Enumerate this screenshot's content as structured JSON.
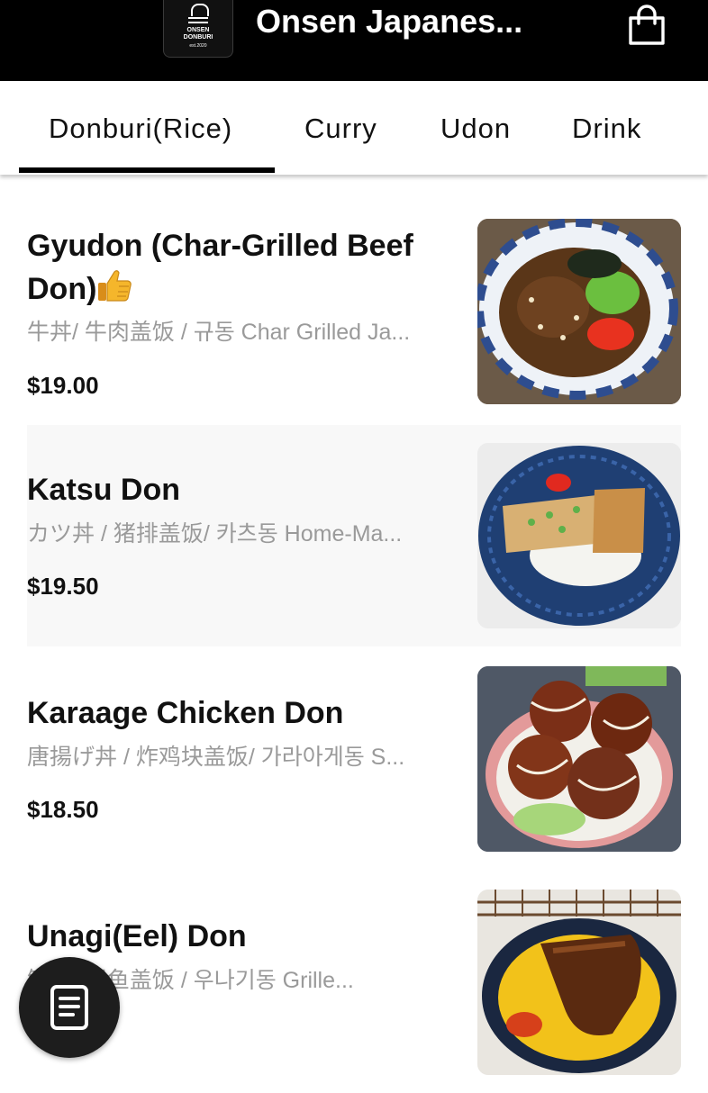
{
  "header": {
    "title": "Onsen Japanes...",
    "logo_line1": "ONSEN",
    "logo_line2": "DONBURI",
    "logo_line3": "est.2020",
    "cart_icon": "shopping-bag-icon"
  },
  "tabs": [
    {
      "label": "Donburi(Rice)",
      "active": true
    },
    {
      "label": "Curry",
      "active": false
    },
    {
      "label": "Udon",
      "active": false
    },
    {
      "label": "Drink",
      "active": false
    }
  ],
  "menu_items": [
    {
      "name": "Gyudon (Char-Grilled Beef Don)",
      "emoji": "thumbs-up-icon",
      "description": "牛丼/ 牛肉盖饭 / 규동 Char Grilled Ja...",
      "price": "$19.00",
      "image": "gyudon-photo"
    },
    {
      "name": "Katsu Don",
      "description": "カツ丼 / 猪排盖饭/ 카츠동 Home-Ma...",
      "price": "$19.50",
      "image": "katsu-don-photo"
    },
    {
      "name": "Karaage Chicken Don",
      "description": "唐揚げ丼 / 炸鸡块盖饭/ 가라아게동 S...",
      "price": "$18.50",
      "image": "karaage-don-photo"
    },
    {
      "name": "Unagi(Eel) Don",
      "description": "鰻丼/ 鳗鱼盖饭 / 우나기동 Grille...",
      "image": "unagi-don-photo"
    }
  ],
  "fab": {
    "icon": "order-list-icon"
  },
  "colors": {
    "header_bg": "#000000",
    "text": "#111111",
    "muted": "#9a9a9a",
    "alt_row": "#f8f8f8"
  }
}
